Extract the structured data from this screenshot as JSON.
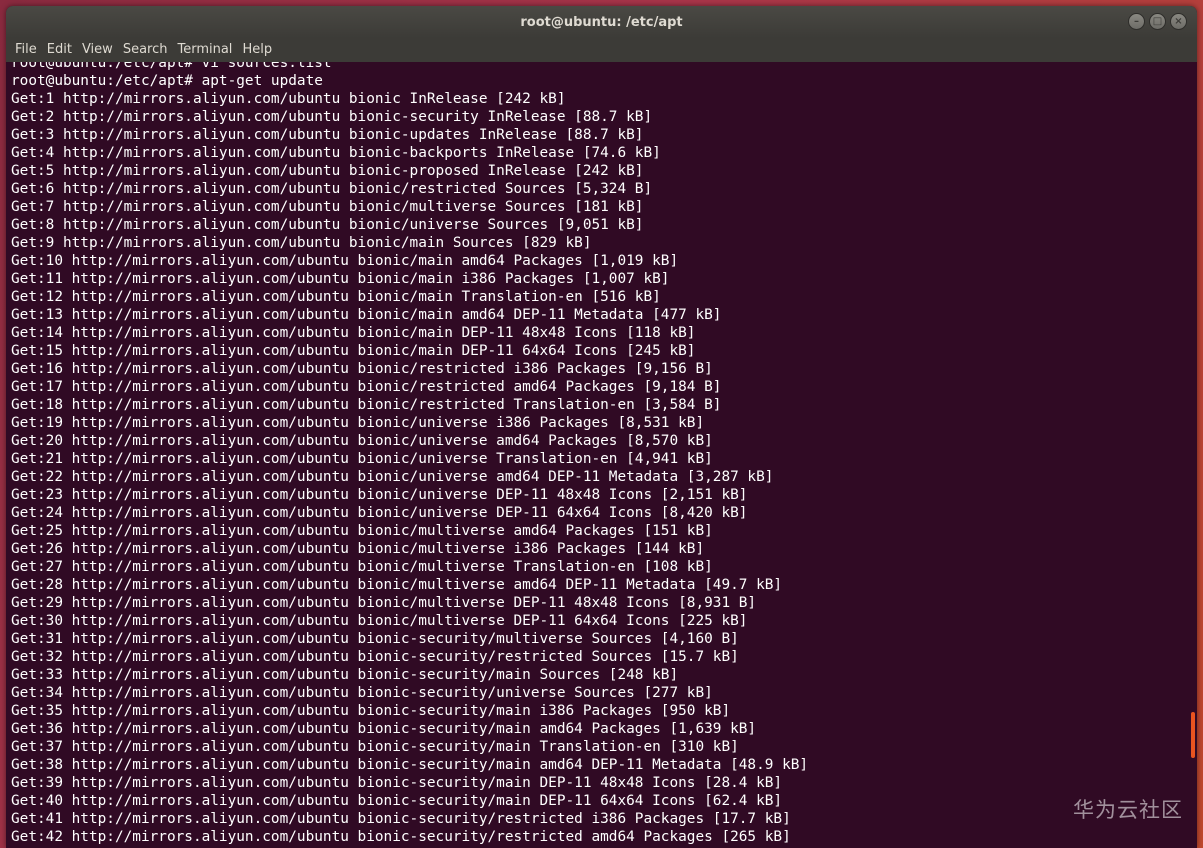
{
  "window": {
    "title": "root@ubuntu: /etc/apt",
    "controls": [
      "minimize",
      "maximize",
      "close"
    ]
  },
  "menubar": {
    "items": [
      "File",
      "Edit",
      "View",
      "Search",
      "Terminal",
      "Help"
    ]
  },
  "terminal": {
    "lines": [
      "root@ubuntu:/etc/apt# vi sources.list",
      "root@ubuntu:/etc/apt# apt-get update",
      "Get:1 http://mirrors.aliyun.com/ubuntu bionic InRelease [242 kB]",
      "Get:2 http://mirrors.aliyun.com/ubuntu bionic-security InRelease [88.7 kB]",
      "Get:3 http://mirrors.aliyun.com/ubuntu bionic-updates InRelease [88.7 kB]",
      "Get:4 http://mirrors.aliyun.com/ubuntu bionic-backports InRelease [74.6 kB]",
      "Get:5 http://mirrors.aliyun.com/ubuntu bionic-proposed InRelease [242 kB]",
      "Get:6 http://mirrors.aliyun.com/ubuntu bionic/restricted Sources [5,324 B]",
      "Get:7 http://mirrors.aliyun.com/ubuntu bionic/multiverse Sources [181 kB]",
      "Get:8 http://mirrors.aliyun.com/ubuntu bionic/universe Sources [9,051 kB]",
      "Get:9 http://mirrors.aliyun.com/ubuntu bionic/main Sources [829 kB]",
      "Get:10 http://mirrors.aliyun.com/ubuntu bionic/main amd64 Packages [1,019 kB]",
      "Get:11 http://mirrors.aliyun.com/ubuntu bionic/main i386 Packages [1,007 kB]",
      "Get:12 http://mirrors.aliyun.com/ubuntu bionic/main Translation-en [516 kB]",
      "Get:13 http://mirrors.aliyun.com/ubuntu bionic/main amd64 DEP-11 Metadata [477 kB]",
      "Get:14 http://mirrors.aliyun.com/ubuntu bionic/main DEP-11 48x48 Icons [118 kB]",
      "Get:15 http://mirrors.aliyun.com/ubuntu bionic/main DEP-11 64x64 Icons [245 kB]",
      "Get:16 http://mirrors.aliyun.com/ubuntu bionic/restricted i386 Packages [9,156 B]",
      "Get:17 http://mirrors.aliyun.com/ubuntu bionic/restricted amd64 Packages [9,184 B]",
      "Get:18 http://mirrors.aliyun.com/ubuntu bionic/restricted Translation-en [3,584 B]",
      "Get:19 http://mirrors.aliyun.com/ubuntu bionic/universe i386 Packages [8,531 kB]",
      "Get:20 http://mirrors.aliyun.com/ubuntu bionic/universe amd64 Packages [8,570 kB]",
      "Get:21 http://mirrors.aliyun.com/ubuntu bionic/universe Translation-en [4,941 kB]",
      "Get:22 http://mirrors.aliyun.com/ubuntu bionic/universe amd64 DEP-11 Metadata [3,287 kB]",
      "Get:23 http://mirrors.aliyun.com/ubuntu bionic/universe DEP-11 48x48 Icons [2,151 kB]",
      "Get:24 http://mirrors.aliyun.com/ubuntu bionic/universe DEP-11 64x64 Icons [8,420 kB]",
      "Get:25 http://mirrors.aliyun.com/ubuntu bionic/multiverse amd64 Packages [151 kB]",
      "Get:26 http://mirrors.aliyun.com/ubuntu bionic/multiverse i386 Packages [144 kB]",
      "Get:27 http://mirrors.aliyun.com/ubuntu bionic/multiverse Translation-en [108 kB]",
      "Get:28 http://mirrors.aliyun.com/ubuntu bionic/multiverse amd64 DEP-11 Metadata [49.7 kB]",
      "Get:29 http://mirrors.aliyun.com/ubuntu bionic/multiverse DEP-11 48x48 Icons [8,931 B]",
      "Get:30 http://mirrors.aliyun.com/ubuntu bionic/multiverse DEP-11 64x64 Icons [225 kB]",
      "Get:31 http://mirrors.aliyun.com/ubuntu bionic-security/multiverse Sources [4,160 B]",
      "Get:32 http://mirrors.aliyun.com/ubuntu bionic-security/restricted Sources [15.7 kB]",
      "Get:33 http://mirrors.aliyun.com/ubuntu bionic-security/main Sources [248 kB]",
      "Get:34 http://mirrors.aliyun.com/ubuntu bionic-security/universe Sources [277 kB]",
      "Get:35 http://mirrors.aliyun.com/ubuntu bionic-security/main i386 Packages [950 kB]",
      "Get:36 http://mirrors.aliyun.com/ubuntu bionic-security/main amd64 Packages [1,639 kB]",
      "Get:37 http://mirrors.aliyun.com/ubuntu bionic-security/main Translation-en [310 kB]",
      "Get:38 http://mirrors.aliyun.com/ubuntu bionic-security/main amd64 DEP-11 Metadata [48.9 kB]",
      "Get:39 http://mirrors.aliyun.com/ubuntu bionic-security/main DEP-11 48x48 Icons [28.4 kB]",
      "Get:40 http://mirrors.aliyun.com/ubuntu bionic-security/main DEP-11 64x64 Icons [62.4 kB]",
      "Get:41 http://mirrors.aliyun.com/ubuntu bionic-security/restricted i386 Packages [17.7 kB]",
      "Get:42 http://mirrors.aliyun.com/ubuntu bionic-security/restricted amd64 Packages [265 kB]"
    ]
  },
  "watermark": "华为云社区",
  "colors": {
    "terminal_bg": "#300a24",
    "terminal_fg": "#ffffff",
    "titlebar_bg": "#3c3b37",
    "scroll_accent": "#e95420"
  }
}
